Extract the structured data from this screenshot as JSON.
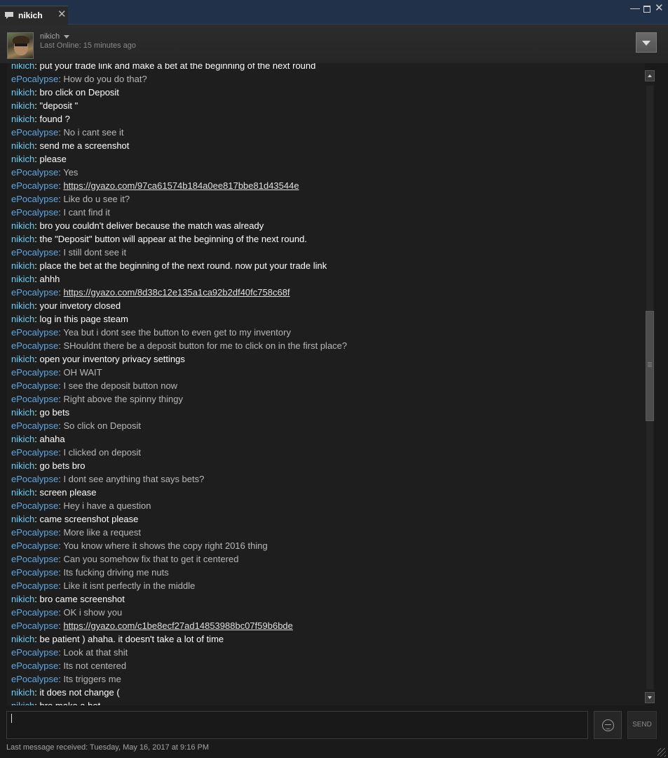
{
  "tab": {
    "title": "nikich",
    "close_label": "✕",
    "icon": "chat-bubble-icon"
  },
  "window_controls": {
    "minimize": "—",
    "close": "✕"
  },
  "header": {
    "user_name": "nikich",
    "last_online": "Last Online: 15 minutes ago",
    "dropdown_icon": "chevron-down-icon"
  },
  "partial_top": {
    "sender": "nikich",
    "text": "put your trade link and make a bet at the beginning of the next round"
  },
  "messages": [
    {
      "sender": "ePocalypse",
      "text": "How do you do that?"
    },
    {
      "sender": "nikich",
      "text": "bro click on Deposit"
    },
    {
      "sender": "nikich",
      "text": "\"deposit \""
    },
    {
      "sender": "nikich",
      "text": "found ?"
    },
    {
      "sender": "ePocalypse",
      "text": "No i cant see it"
    },
    {
      "sender": "nikich",
      "text": "send me a screenshot"
    },
    {
      "sender": "nikich",
      "text": "please"
    },
    {
      "sender": "ePocalypse",
      "text": "Yes"
    },
    {
      "sender": "ePocalypse",
      "link": "https://gyazo.com/97ca61574b184a0ee817bbe81d43544e"
    },
    {
      "sender": "ePocalypse",
      "text": "Like do u see it?"
    },
    {
      "sender": "ePocalypse",
      "text": "I cant find it"
    },
    {
      "sender": "nikich",
      "text": "bro you couldn't deliver because the match was already"
    },
    {
      "sender": "nikich",
      "text": "the \"Deposit\" button will appear at the beginning of the next round."
    },
    {
      "sender": "ePocalypse",
      "text": "I still dont see it"
    },
    {
      "sender": "nikich",
      "text": "place the bet at the beginning of the next round. now put your trade link"
    },
    {
      "sender": "nikich",
      "text": "ahhh"
    },
    {
      "sender": "ePocalypse",
      "link": "https://gyazo.com/8d38c12e135a1ca92b2df40fc758c68f"
    },
    {
      "sender": "nikich",
      "text": "your invetory closed"
    },
    {
      "sender": "nikich",
      "text": "log in this page steam"
    },
    {
      "sender": "ePocalypse",
      "text": "Yea but i dont see the button to even get to my inventory"
    },
    {
      "sender": "ePocalypse",
      "text": "SHouldnt there be a deposit button for me to click on in the first place?"
    },
    {
      "sender": "nikich",
      "text": "open your inventory privacy settings"
    },
    {
      "sender": "ePocalypse",
      "text": "OH WAIT"
    },
    {
      "sender": "ePocalypse",
      "text": "I see the deposit button now"
    },
    {
      "sender": "ePocalypse",
      "text": "Right above the spinny thingy"
    },
    {
      "sender": "nikich",
      "text": "go bets"
    },
    {
      "sender": "ePocalypse",
      "text": "So click on Deposit"
    },
    {
      "sender": "nikich",
      "text": "ahaha"
    },
    {
      "sender": "ePocalypse",
      "text": "I clicked on deposit"
    },
    {
      "sender": "nikich",
      "text": "go bets bro"
    },
    {
      "sender": "ePocalypse",
      "text": "I dont see anything that says bets?"
    },
    {
      "sender": "nikich",
      "text": "screen please"
    },
    {
      "sender": "ePocalypse",
      "text": "Hey i have a question"
    },
    {
      "sender": "nikich",
      "text": "came screenshot please"
    },
    {
      "sender": "ePocalypse",
      "text": "More like a request"
    },
    {
      "sender": "ePocalypse",
      "text": "You know where it shows the copy right 2016 thing"
    },
    {
      "sender": "ePocalypse",
      "text": "Can you somehow fix that to get it centered"
    },
    {
      "sender": "ePocalypse",
      "text": "Its fucking driving me nuts"
    },
    {
      "sender": "ePocalypse",
      "text": "Like it isnt perfectly in the middle"
    },
    {
      "sender": "nikich",
      "text": "bro came screenshot"
    },
    {
      "sender": "ePocalypse",
      "text": "OK i show you"
    },
    {
      "sender": "ePocalypse",
      "link": "https://gyazo.com/c1be8ecf27ad14853988bc07f59b6bde"
    },
    {
      "sender": "nikich",
      "text": "be patient ) ahaha. it doesn't take a lot of time"
    },
    {
      "sender": "ePocalypse",
      "text": "Look at that shit"
    },
    {
      "sender": "ePocalypse",
      "text": "Its not centered"
    },
    {
      "sender": "ePocalypse",
      "text": "Its triggers me"
    },
    {
      "sender": "nikich",
      "text": "it does not change ("
    }
  ],
  "partial_bottom": {
    "sender": "nikich",
    "text": "bro make a bet"
  },
  "input": {
    "value": ""
  },
  "send_label": "SEND",
  "emoji_icon": "emoticon-icon",
  "status": "Last message received: Tuesday, May 16, 2017 at 9:16 PM",
  "colors": {
    "nikich": "#6dcff6",
    "ePocalypse": "#62a7e3",
    "background": "#1e1e1e",
    "titlebar": "#213149"
  }
}
